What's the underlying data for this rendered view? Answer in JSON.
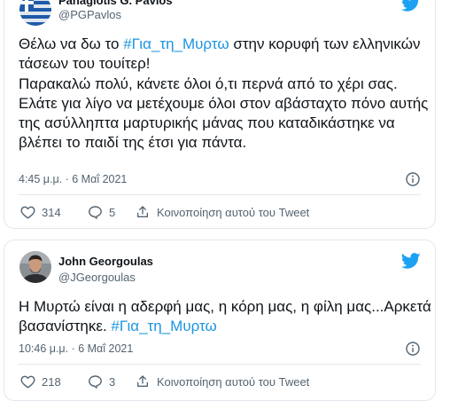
{
  "colors": {
    "accent": "#1da1f2",
    "hashtag": "#1b95e0",
    "secondary": "#536471",
    "border": "#e1e8ed"
  },
  "tweets": [
    {
      "name": "Panagiotis G. Pavlos",
      "handle": "@PGPavlos",
      "avatar_icon": "avatar-flag-icon",
      "text": [
        {
          "pre": "Θέλω να δω το ",
          "tag": "#Για_τη_Μυρτω",
          "post": " στην κορυφή των ελληνικών τάσεων του τουίτερ!"
        },
        {
          "pre": "Παρακαλώ πολύ, κάνετε όλοι ό,τι περνά από το χέρι σας.",
          "tag": "",
          "post": ""
        },
        {
          "pre": "Ελάτε για λίγο να μετέχουμε όλοι στον αβάσταχτο πόνο αυτής της ασύλληπτα μαρτυρικής μάνας που καταδικάστηκε να βλέπει το παιδί της έτσι για πάντα.",
          "tag": "",
          "post": ""
        }
      ],
      "timestamp": "4:45 μ.μ. · 6 Μαΐ 2021",
      "likes": "314",
      "replies": "5",
      "share_label": "Κοινοποίηση αυτού του Tweet"
    },
    {
      "name": "John Georgoulas",
      "handle": "@JGeorgoulas",
      "avatar_icon": "avatar-photo-icon",
      "text": [
        {
          "pre": "Η Μυρτώ είναι η αδερφή μας, η κόρη μας, η φίλη μας...Αρκετά βασανίστηκε. ",
          "tag": "#Για_τη_Μυρτω",
          "post": ""
        }
      ],
      "timestamp": "10:46 μ.μ. · 6 Μαΐ 2021",
      "likes": "218",
      "replies": "3",
      "share_label": "Κοινοποίηση αυτού του Tweet"
    }
  ]
}
